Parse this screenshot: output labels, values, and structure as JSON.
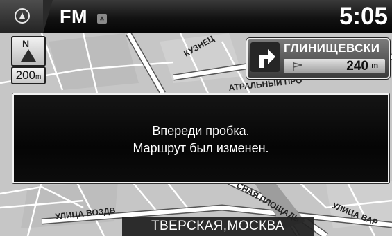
{
  "status_bar": {
    "audio_source": "FM",
    "antenna_icon": "antenna-icon",
    "clock": "5:05",
    "home_icon": "home-icon"
  },
  "map": {
    "compass_label": "N",
    "scale_value": "200",
    "scale_unit": "m",
    "street_labels": [
      "КУЗНЕЦ",
      "АТРАЛЬНЫЙ ПРО",
      "СНАЯ ПЛОЩАДЬ",
      "УЛИЦА ВАР",
      "УЛИЦА ВОЗДВ"
    ]
  },
  "guidance": {
    "next_street": "ГЛИНИЩЕВСКИ",
    "distance": "240",
    "distance_unit": "m",
    "turn_icon": "turn-right-icon"
  },
  "popup": {
    "line1": "Впереди пробка.",
    "line2": "Маршрут был изменен."
  },
  "current_road": "ТВЕРСКАЯ,МОСКВА",
  "colors": {
    "map_background": "#c9c9c9",
    "road": "#ffffff",
    "popup_background": "#0a0a0a",
    "status_bar": "#111111"
  }
}
